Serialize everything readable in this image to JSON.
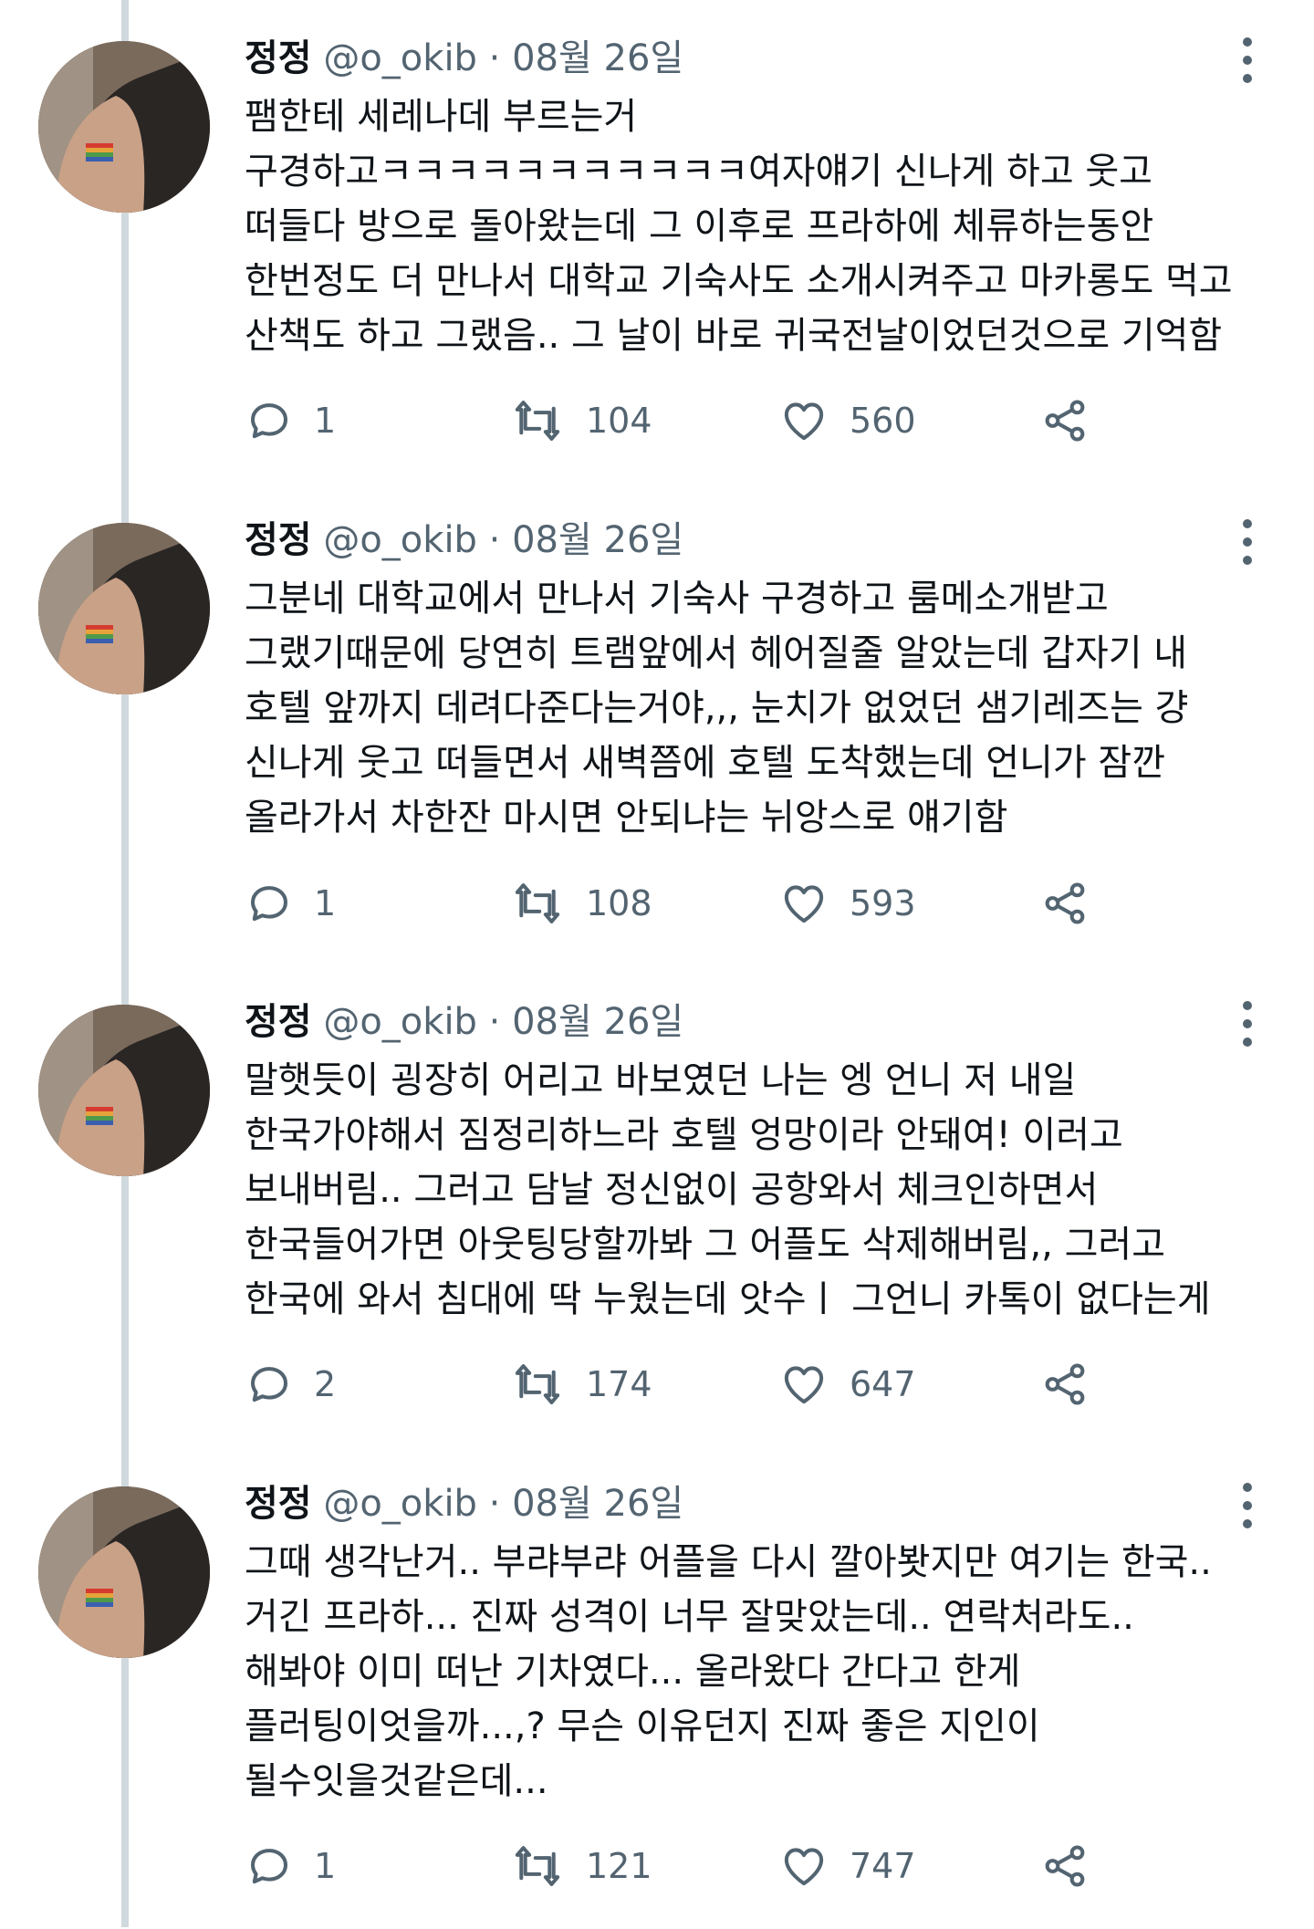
{
  "tweets": [
    {
      "display_name": "정정",
      "handle": "@o_okib",
      "separator": "·",
      "date": "08월 26일",
      "lines": [
        "팸한테 세레나데 부르는거",
        "구경하고ㅋㅋㅋㅋㅋㅋㅋㅋㅋㅋㅋ여자얘기 신나게 하고 웃고",
        "떠들다 방으로 돌아왔는데 그 이후로 프라하에 체류하는동안",
        "한번정도 더 만나서 대학교 기숙사도 소개시켜주고 마카롱도 먹고",
        "산책도 하고 그랬음.. 그 날이 바로 귀국전날이었던것으로 기억함"
      ],
      "replies": "1",
      "retweets": "104",
      "likes": "560"
    },
    {
      "display_name": "정정",
      "handle": "@o_okib",
      "separator": "·",
      "date": "08월 26일",
      "lines": [
        "그분네 대학교에서 만나서 기숙사 구경하고 룸메소개받고",
        "그랬기때문에 당연히 트램앞에서 헤어질줄 알았는데 갑자기 내",
        "호텔 앞까지 데려다준다는거야,,, 눈치가 없었던 샘기레즈는 걍",
        "신나게 웃고 떠들면서 새벽쯤에 호텔 도착했는데 언니가 잠깐",
        "올라가서 차한잔 마시면 안되냐는 뉘앙스로 얘기함"
      ],
      "replies": "1",
      "retweets": "108",
      "likes": "593"
    },
    {
      "display_name": "정정",
      "handle": "@o_okib",
      "separator": "·",
      "date": "08월 26일",
      "lines": [
        "말햇듯이 굉장히 어리고 바보였던 나는 엥 언니 저 내일",
        "한국가야해서 짐정리하느라 호텔 엉망이라 안돼여! 이러고",
        "보내버림.. 그러고 담날 정신없이 공항와서 체크인하면서",
        "한국들어가면 아웃팅당할까봐 그 어플도 삭제해버림,, 그러고",
        "한국에 와서 침대에 딱 누웠는데 앗수ㅣ 그언니 카톡이 없다는게"
      ],
      "replies": "2",
      "retweets": "174",
      "likes": "647"
    },
    {
      "display_name": "정정",
      "handle": "@o_okib",
      "separator": "·",
      "date": "08월 26일",
      "lines": [
        "그때 생각난거.. 부랴부랴 어플을 다시  깔아봣지만 여기는 한국..",
        "거긴 프라하... 진짜 성격이 너무 잘맞았는데.. 연락처라도..",
        "해봐야 이미 떠난 기차였다... 올라왔다 간다고 한게",
        "플러팅이엇을까...,? 무슨 이유던지 진짜 좋은 지인이",
        "될수잇을것같은데..."
      ],
      "replies": "1",
      "retweets": "121",
      "likes": "747"
    }
  ],
  "icons": {
    "reply": "reply-bubble-icon",
    "retweet": "retweet-icon",
    "like": "heart-icon",
    "share": "share-icon",
    "more": "more-vertical-icon"
  },
  "colors": {
    "text": "#0f1419",
    "secondary": "#536471",
    "thread_line": "#cfd9de",
    "background": "#ffffff"
  }
}
